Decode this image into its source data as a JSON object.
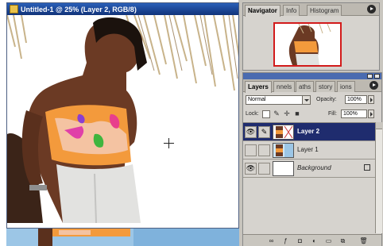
{
  "document": {
    "title": "Untitled-1 @ 25% (Layer 2, RGB/8)",
    "icon": "photoshop-document-icon"
  },
  "navigator_panel": {
    "tabs": [
      {
        "label": "Navigator",
        "active": true
      },
      {
        "label": "Info",
        "active": false
      },
      {
        "label": "Histogram",
        "active": false
      }
    ],
    "view_box_color": "#d21b1b"
  },
  "layers_panel": {
    "tabs": [
      {
        "label": "Layers",
        "active": true
      },
      {
        "label": "nnels",
        "active": false
      },
      {
        "label": "aths",
        "active": false
      },
      {
        "label": "story",
        "active": false
      },
      {
        "label": "ions",
        "active": false
      }
    ],
    "blend_mode": "Normal",
    "opacity_label": "Opacity:",
    "opacity_value": "100%",
    "lock_label": "Lock:",
    "fill_label": "Fill:",
    "fill_value": "100%",
    "layers": [
      {
        "name": "Layer 2",
        "visible": true,
        "selected": true,
        "italic": false
      },
      {
        "name": "Layer 1",
        "visible": false,
        "selected": false,
        "italic": false
      },
      {
        "name": "Background",
        "visible": true,
        "selected": false,
        "italic": true,
        "locked": true
      }
    ],
    "footer_icons": [
      "link-icon",
      "layer-style-icon",
      "mask-icon",
      "adjustment-layer-icon",
      "group-icon",
      "new-layer-icon",
      "trash-icon"
    ]
  },
  "colors": {
    "titlebar": "#1b3f8f",
    "selected_layer": "#1f2c6e",
    "panel_bg": "#d6d3ce"
  }
}
